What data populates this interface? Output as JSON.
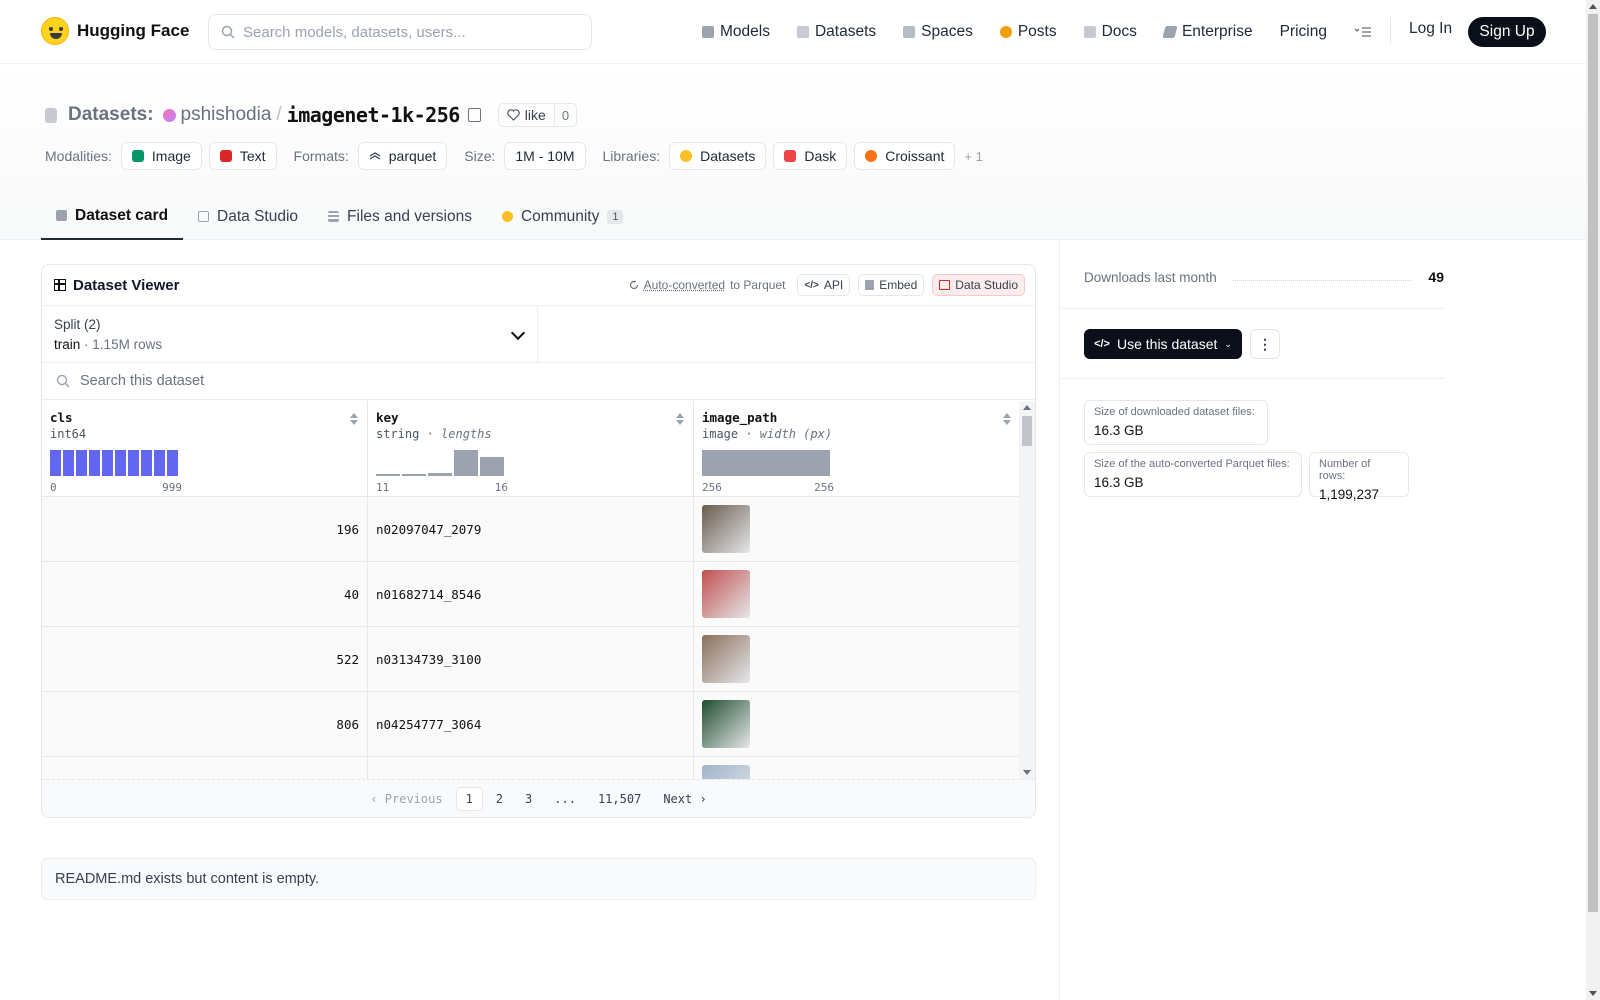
{
  "nav": {
    "brand": "Hugging Face",
    "search_placeholder": "Search models, datasets, users...",
    "links": [
      {
        "label": "Models",
        "icon": "cube-icon",
        "color": "#6b7280"
      },
      {
        "label": "Datasets",
        "icon": "database-icon",
        "color": "#9ca3af"
      },
      {
        "label": "Spaces",
        "icon": "grid-icon",
        "color": "#9ca3af"
      },
      {
        "label": "Posts",
        "icon": "speech-bubble-icon",
        "color": "#f59e0b"
      },
      {
        "label": "Docs",
        "icon": "book-icon",
        "color": "#9ca3af"
      },
      {
        "label": "Enterprise",
        "icon": "enterprise-icon",
        "color": "#6b7280"
      },
      {
        "label": "Pricing"
      }
    ],
    "login": "Log In",
    "signup": "Sign Up"
  },
  "header": {
    "section": "Datasets:",
    "owner": "pshishodia",
    "slash": "/",
    "name": "imagenet-1k-256",
    "like_label": "like",
    "like_count": "0",
    "modalities_label": "Modalities:",
    "modalities": [
      {
        "label": "Image",
        "color": "#059669"
      },
      {
        "label": "Text",
        "color": "#dc2626"
      }
    ],
    "formats_label": "Formats:",
    "format": "parquet",
    "size_label": "Size:",
    "size": "1M - 10M",
    "libraries_label": "Libraries:",
    "libraries": [
      {
        "label": "Datasets",
        "color": "#fbbf24"
      },
      {
        "label": "Dask",
        "color": "#ef4444"
      },
      {
        "label": "Croissant",
        "color": "#f97316"
      }
    ],
    "libraries_more": "+ 1"
  },
  "tabs": [
    {
      "label": "Dataset card",
      "icon": "cube-icon"
    },
    {
      "label": "Data Studio",
      "icon": "table-icon"
    },
    {
      "label": "Files and versions",
      "icon": "files-icon"
    },
    {
      "label": "Community",
      "icon": "community-icon",
      "badge": "1"
    }
  ],
  "viewer": {
    "title": "Dataset Viewer",
    "auto_converted": "Auto-converted",
    "to_parquet": "to Parquet",
    "api": "API",
    "embed": "Embed",
    "data_studio": "Data Studio",
    "split_label": "Split (2)",
    "split_value": "train",
    "split_dot": "·",
    "split_rows": "1.15M rows",
    "search_placeholder": "Search this dataset",
    "columns": [
      {
        "name": "cls",
        "type": "int64",
        "sub": "",
        "range_min": "0",
        "range_max": "999"
      },
      {
        "name": "key",
        "type": "string",
        "sub": "· lengths",
        "range_min": "11",
        "range_max": "16"
      },
      {
        "name": "image_path",
        "type": "image",
        "sub": "· width (px)",
        "range_min": "256",
        "range_max": "256"
      }
    ],
    "cls_hist": [
      1,
      1,
      1,
      1,
      1,
      1,
      1,
      1,
      1,
      1
    ],
    "key_hist": [
      0.05,
      0.05,
      0.12,
      1,
      0.75
    ],
    "rows": [
      {
        "cls": "196",
        "key": "n02097047_2079",
        "img": "#6b5b4e"
      },
      {
        "cls": "40",
        "key": "n01682714_8546",
        "img": "#c0504d"
      },
      {
        "cls": "522",
        "key": "n03134739_3100",
        "img": "#8b6f5a"
      },
      {
        "cls": "806",
        "key": "n04254777_3064",
        "img": "#1f4d2e"
      },
      {
        "cls": "",
        "key": "",
        "img": "#9fb4c9"
      }
    ],
    "pager": {
      "prev": "Previous",
      "pages": [
        "1",
        "2",
        "3",
        "...",
        "11,507"
      ],
      "next": "Next"
    }
  },
  "readme": "README.md exists but content is empty.",
  "side": {
    "downloads_label": "Downloads last month",
    "downloads_value": "49",
    "use_button": "Use this dataset",
    "more": "⋮",
    "stats": [
      {
        "label": "Size of downloaded dataset files:",
        "value": "16.3 GB"
      },
      {
        "label": "Size of the auto-converted Parquet files:",
        "value": "16.3 GB"
      },
      {
        "label": "Number of rows:",
        "value": "1,199,237"
      }
    ]
  }
}
